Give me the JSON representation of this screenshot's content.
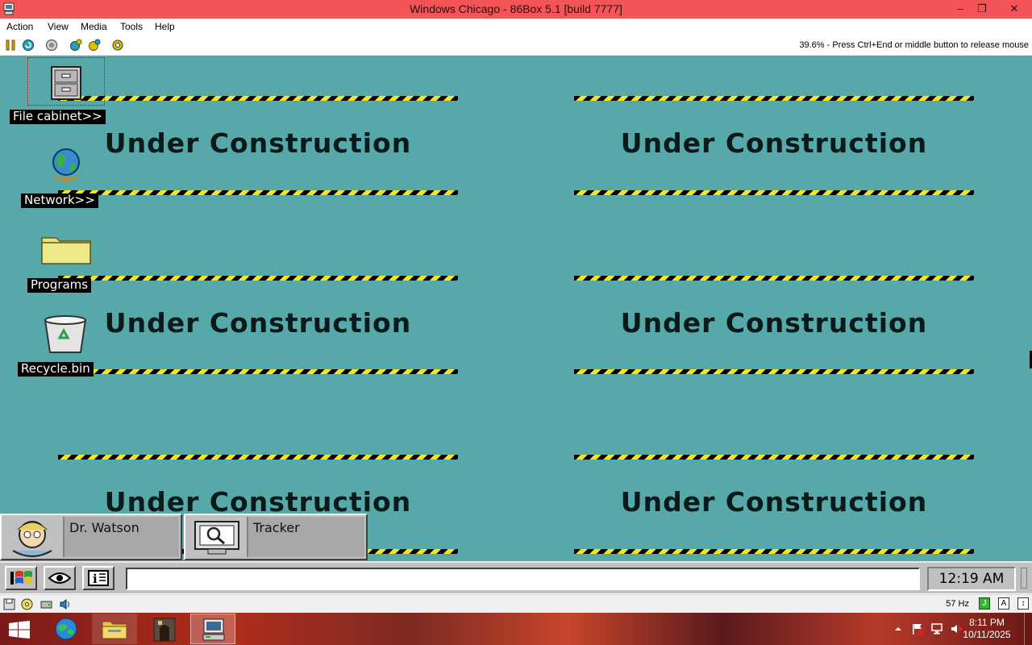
{
  "window": {
    "title": "Windows Chicago - 86Box 5.1 [build 7777]",
    "minimize_glyph": "–",
    "restore_glyph": "❐",
    "close_glyph": "✕"
  },
  "menu": {
    "items": [
      "Action",
      "View",
      "Media",
      "Tools",
      "Help"
    ]
  },
  "toolbar": {
    "icons": [
      "pause-icon",
      "reset-icon",
      "ctrl-alt-del-icon",
      "ctrl-alt-esc-icon",
      "hard-reset-icon",
      "settings-icon"
    ],
    "status": "39.6% - Press Ctrl+End or middle button to release mouse"
  },
  "desktop": {
    "icons": [
      {
        "label": "File cabinet>>",
        "icon": "file-cabinet-icon"
      },
      {
        "label": "Network>>",
        "icon": "globe-icon"
      },
      {
        "label": "Programs",
        "icon": "folder-icon"
      },
      {
        "label": "Recycle.bin",
        "icon": "recycle-bin-icon"
      }
    ],
    "banner_text": "Under Construction",
    "stripe_colors": [
      "#000000",
      "#f0e628"
    ],
    "background_color": "#57a8a8"
  },
  "minimized_apps": [
    {
      "label": "Dr. Watson",
      "icon": "dr-watson-icon"
    },
    {
      "label": "Tracker",
      "icon": "tracker-icon"
    }
  ],
  "guest_taskbar": {
    "buttons": [
      "windows-flag-icon",
      "eye-icon",
      "info-icon"
    ],
    "clock": "12:19 AM"
  },
  "statusbar": {
    "icons": [
      "floppy-icon",
      "cdrom-icon",
      "hard-disk-icon",
      "sound-icon"
    ],
    "refresh_rate": "57 Hz",
    "indicators": [
      "J",
      "A",
      "↕"
    ]
  },
  "host_taskbar": {
    "apps": [
      "internet-explorer-icon",
      "file-explorer-icon",
      "app-icon",
      "86box-icon"
    ],
    "tray_icons": [
      "show-hidden-icons-icon",
      "action-center-flag-icon",
      "network-icon",
      "volume-muted-icon"
    ],
    "time": "8:11 PM",
    "date": "10/11/2025"
  }
}
